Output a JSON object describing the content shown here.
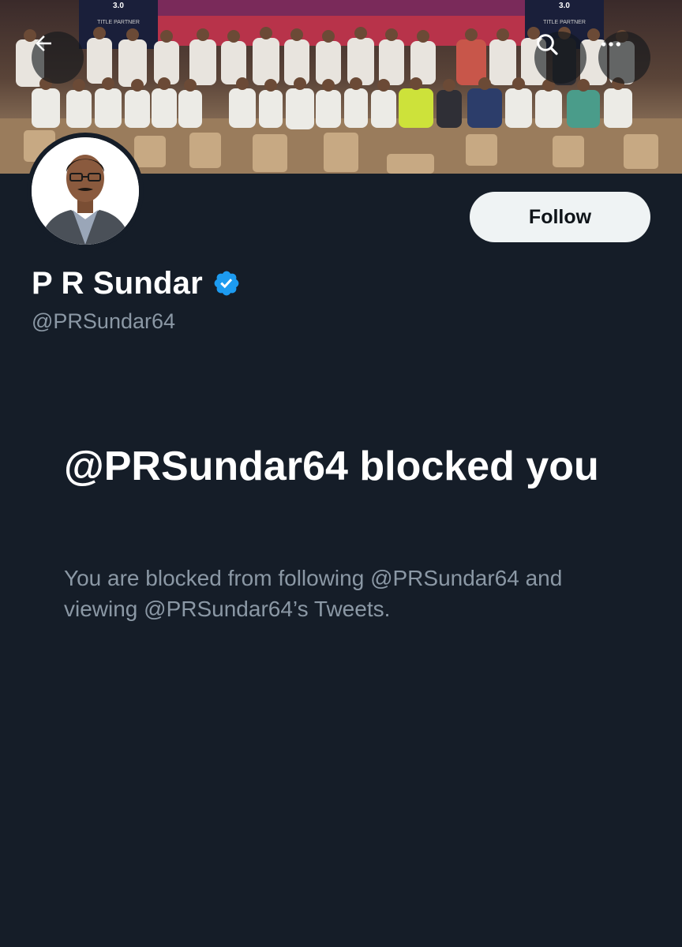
{
  "header": {
    "back_icon": "arrow-left-icon",
    "search_icon": "search-icon",
    "more_icon": "more-horizontal-icon"
  },
  "banner": {
    "image": "group-photo-banner",
    "stage_left_text": "3.0",
    "stage_left_sub": "TITLE PARTNER",
    "stage_right_text": "3.0",
    "stage_right_sub": "TITLE PARTNER"
  },
  "profile": {
    "display_name": "P R Sundar",
    "handle": "@PRSundar64",
    "verified": true,
    "verified_color": "#1d9bf0",
    "follow_label": "Follow"
  },
  "blocked": {
    "title": "@PRSundar64 blocked you",
    "description": "You are blocked from following @PRSundar64 and viewing @PRSundar64’s Tweets."
  },
  "colors": {
    "background": "#151d28",
    "primary_text": "#ffffff",
    "secondary_text": "#8b98a5",
    "follow_bg": "#eff3f4",
    "follow_text": "#0f1419"
  }
}
